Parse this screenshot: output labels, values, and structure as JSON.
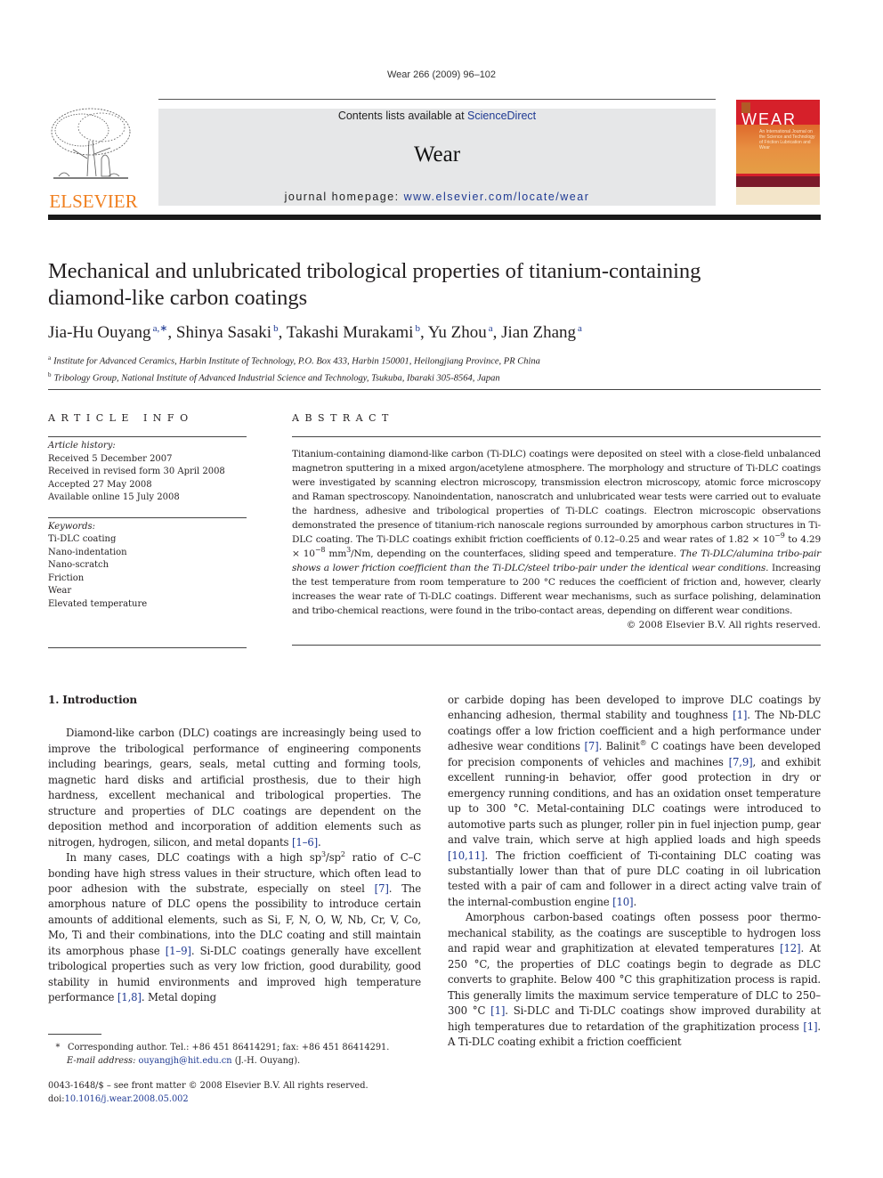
{
  "running_head": "Wear 266 (2009) 96–102",
  "masthead": {
    "contents_prefix": "Contents lists available at ",
    "contents_link": "ScienceDirect",
    "journal_name": "Wear",
    "homepage_prefix": "journal homepage: ",
    "homepage_link": "www.elsevier.com/locate/wear"
  },
  "publisher": {
    "wordmark": "ELSEVIER",
    "color": "#f07f1e"
  },
  "cover": {
    "title": "WEAR",
    "subtitle": "An International Journal on the Science and Technology of Friction Lubrication and Wear",
    "colors": {
      "red": "#d6202a",
      "dark_band": "#7b1a2a"
    }
  },
  "article": {
    "title_line1": "Mechanical and unlubricated tribological properties of titanium-containing",
    "title_line2": "diamond-like carbon coatings",
    "authors": [
      {
        "name": "Jia-Hu Ouyang",
        "affil": "a,∗"
      },
      {
        "name": "Shinya Sasaki",
        "affil": "b"
      },
      {
        "name": "Takashi Murakami",
        "affil": "b"
      },
      {
        "name": "Yu Zhou",
        "affil": "a"
      },
      {
        "name": "Jian Zhang",
        "affil": "a"
      }
    ],
    "affiliations": [
      {
        "key": "a",
        "text": "Institute for Advanced Ceramics, Harbin Institute of Technology, P.O. Box 433, Harbin 150001, Heilongjiang Province, PR China"
      },
      {
        "key": "b",
        "text": "Tribology Group, National Institute of Advanced Industrial Science and Technology, Tsukuba, Ibaraki 305-8564, Japan"
      }
    ]
  },
  "article_info": {
    "heading": "ARTICLE INFO",
    "history_label": "Article history:",
    "history": [
      "Received 5 December 2007",
      "Received in revised form 30 April 2008",
      "Accepted 27 May 2008",
      "Available online 15 July 2008"
    ],
    "keywords_label": "Keywords:",
    "keywords": [
      "Ti-DLC coating",
      "Nano-indentation",
      "Nano-scratch",
      "Friction",
      "Wear",
      "Elevated temperature"
    ]
  },
  "abstract": {
    "heading": "ABSTRACT",
    "part1": "Titanium-containing diamond-like carbon (Ti-DLC) coatings were deposited on steel with a close-field unbalanced magnetron sputtering in a mixed argon/acetylene atmosphere. The morphology and structure of Ti-DLC coatings were investigated by scanning electron microscopy, transmission electron microscopy, atomic force microscopy and Raman spectroscopy. Nanoindentation, nanoscratch and unlubricated wear tests were carried out to evaluate the hardness, adhesive and tribological properties of Ti-DLC coatings. Electron microscopic observations demonstrated the presence of titanium-rich nanoscale regions surrounded by amorphous carbon structures in Ti-DLC coating. The Ti-DLC coatings exhibit friction coefficients of 0.12–0.25 and wear rates of 1.82 × 10",
    "exp1": "−9",
    "part2": " to 4.29 × 10",
    "exp2": "−8",
    "part3": " mm",
    "exp3": "3",
    "part4": "/Nm, depending on the counterfaces, sliding speed and temperature. ",
    "italic": "The Ti-DLC/alumina tribo-pair shows a lower friction coefficient than the Ti-DLC/steel tribo-pair under the identical wear conditions.",
    "part5": " Increasing the test temperature from room temperature to 200 °C reduces the coefficient of friction and, however, clearly increases the wear rate of Ti-DLC coatings. Different wear mechanisms, such as surface polishing, delamination and tribo-chemical reactions, were found in the tribo-contact areas, depending on different wear conditions.",
    "copyright": "© 2008 Elsevier B.V. All rights reserved."
  },
  "body": {
    "section_heading": "1.  Introduction",
    "p1": {
      "text": "Diamond-like carbon (DLC) coatings are increasingly being used to improve the tribological performance of engineering components including bearings, gears, seals, metal cutting and forming tools, magnetic hard disks and artificial prosthesis, due to their high hardness, excellent mechanical and tribological properties. The structure and properties of DLC coatings are dependent on the deposition method and incorporation of addition elements such as nitrogen, hydrogen, silicon, and metal dopants ",
      "ref1": "[1–6]",
      "end": "."
    },
    "p2": {
      "a": "In many cases, DLC coatings with a high sp",
      "sup1": "3",
      "b": "/sp",
      "sup2": "2",
      "c": " ratio of C–C bonding have high stress values in their structure, which often lead to poor adhesion with the substrate, especially on steel ",
      "ref1": "[7]",
      "d": ". The amorphous nature of DLC opens the possibility to introduce certain amounts of additional elements, such as Si, F, N, O, W, Nb, Cr, V, Co, Mo, Ti and their combinations, into the DLC coating and still maintain its amorphous phase ",
      "ref2": "[1–9]",
      "e": ". Si-DLC coatings generally have excellent tribological properties such as very low friction, good durability, good stability in humid environments and improved high temperature performance ",
      "ref3": "[1,8]",
      "f": ". Metal doping or carbide doping has been developed to improve DLC coatings by enhancing adhesion, thermal stability and toughness ",
      "ref4": "[1]",
      "g": ". The Nb-DLC coatings offer a low friction coefficient and a high performance under adhesive wear conditions ",
      "ref5": "[7]",
      "h": ". Balinit",
      "reg": "®",
      "i": " C coatings have been developed for precision components of vehicles and machines ",
      "ref6": "[7,9]",
      "j": ", and exhibit excellent running-in behavior, offer good protection in dry or emergency running conditions, and has an oxidation onset temperature up to 300 °C. Metal-containing DLC coatings were introduced to automotive parts such as plunger, roller pin in fuel injection pump, gear and valve train, which serve at high applied loads and high speeds ",
      "ref7": "[10,11]",
      "k": ". The friction coefficient of Ti-containing DLC coating was substantially lower than that of pure DLC coating in oil lubrication tested with a pair of cam and follower in a direct acting valve train of the internal-combustion engine ",
      "ref8": "[10]",
      "l": "."
    },
    "p3": {
      "a": "Amorphous carbon-based coatings often possess poor thermo-mechanical stability, as the coatings are susceptible to hydrogen loss and rapid wear and graphitization at elevated temperatures ",
      "ref1": "[12]",
      "b": ". At 250 °C, the properties of DLC coatings begin to degrade as DLC converts to graphite. Below 400 °C this graphitization process is rapid. This generally limits the maximum service temperature of DLC to 250–300 °C ",
      "ref2": "[1]",
      "c": ". Si-DLC and Ti-DLC coatings show improved durability at high temperatures due to retardation of the graphitization process ",
      "ref3": "[1]",
      "d": ". A Ti-DLC coating exhibit a friction coefficient"
    }
  },
  "footnote": {
    "star": "*",
    "text": "Corresponding author. Tel.: +86 451 86414291; fax: +86 451 86414291.",
    "email_label": "E-mail address:",
    "email": "ouyangjh@hit.edu.cn",
    "email_suffix": " (J.-H. Ouyang)."
  },
  "front_matter": {
    "issn_line": "0043-1648/$ – see front matter © 2008 Elsevier B.V. All rights reserved.",
    "doi_prefix": "doi:",
    "doi": "10.1016/j.wear.2008.05.002"
  },
  "colors": {
    "link": "#1f3a93",
    "masthead_bg": "#e6e7e8",
    "elsevier_orange": "#f07f1e"
  }
}
